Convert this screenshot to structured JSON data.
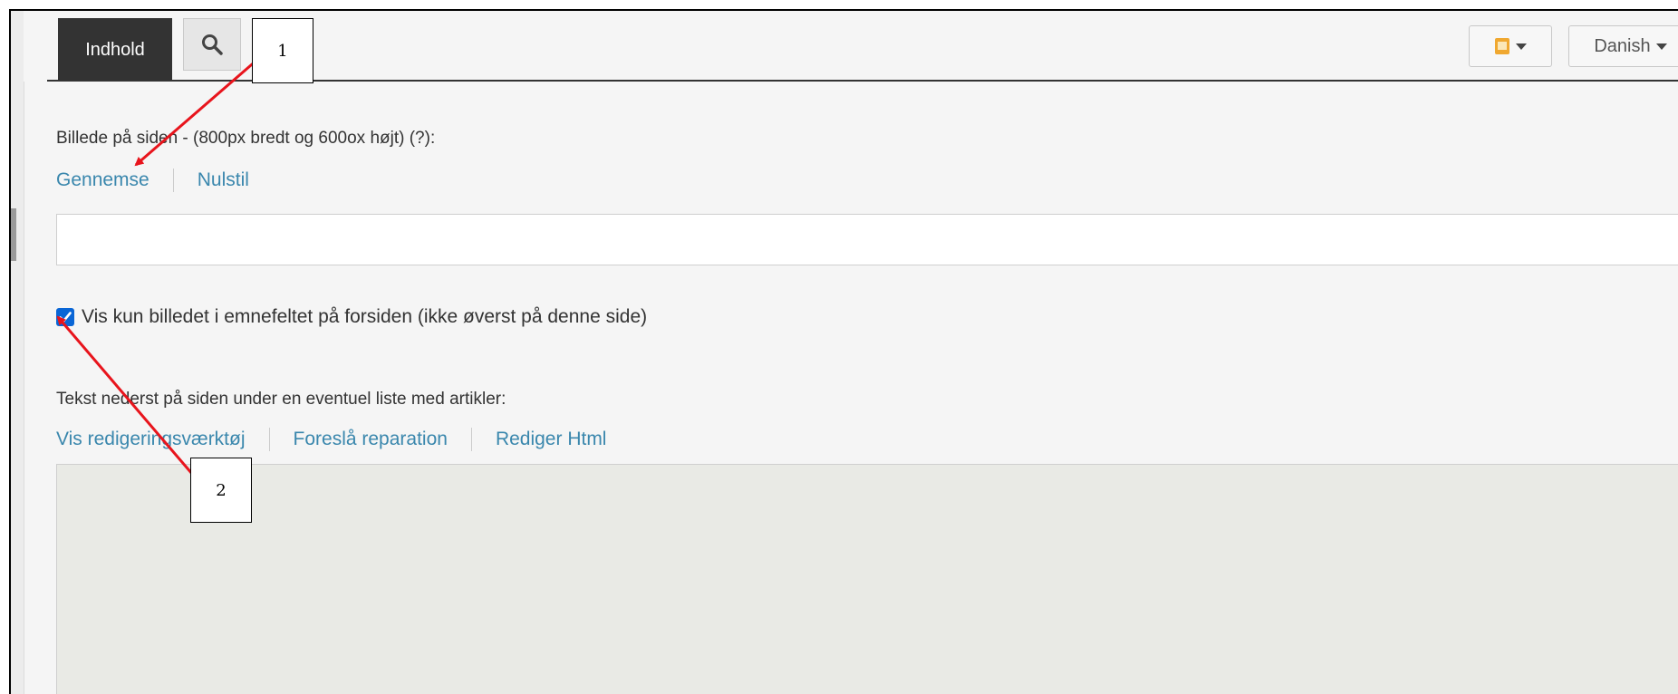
{
  "toolbar": {
    "tab_label": "Indhold",
    "search_icon": "search-icon",
    "clipboard_icon": "clipboard-icon",
    "language_label": "Danish"
  },
  "image_section": {
    "label": "Billede på siden - (800px bredt og 600ox højt) (?):",
    "links": [
      "Gennemse",
      "Nulstil"
    ],
    "checkbox_checked": true,
    "checkbox_label": "Vis kun billedet i emnefeltet på forsiden (ikke øverst på denne side)"
  },
  "text_section": {
    "label": "Tekst nederst på siden under en eventuel liste med artikler:",
    "links": [
      "Vis redigeringsværktøj",
      "Foreslå reparation",
      "Rediger Html"
    ]
  },
  "annotations": [
    "1",
    "2"
  ],
  "colors": {
    "link": "#3a87ad",
    "active_tab": "#333333",
    "checkbox": "#0a66d6",
    "annotation_arrow": "#e8141c"
  }
}
